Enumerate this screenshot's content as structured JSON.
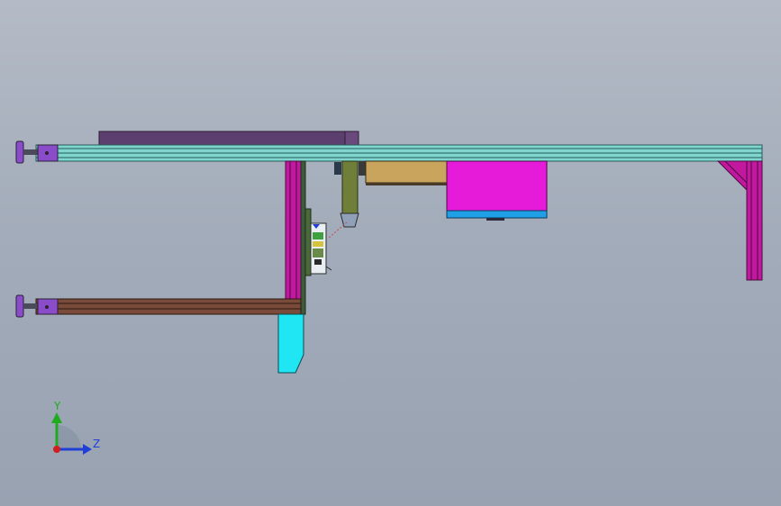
{
  "viewport": {
    "background_top": "#b4bbc6",
    "background_bottom": "#98a2b1"
  },
  "triad": {
    "y_label": "Y",
    "z_label": "Z",
    "y_color": "#1faa1f",
    "z_color": "#1f3fd6",
    "x_color": "#d11f1f"
  },
  "colors": {
    "rail_cyan": "#7fd6cf",
    "rail_brown": "#7a4a3a",
    "plate_purple": "#5c3f6e",
    "foot_purple": "#8a4cc9",
    "post_magenta": "#c2189f",
    "box_magenta": "#e61bd9",
    "box_blue": "#1f9fe6",
    "tan": "#c9a45c",
    "olive": "#6f7f3a",
    "guard_cyan": "#1fe6f2",
    "dark_green": "#3f5a3a"
  }
}
